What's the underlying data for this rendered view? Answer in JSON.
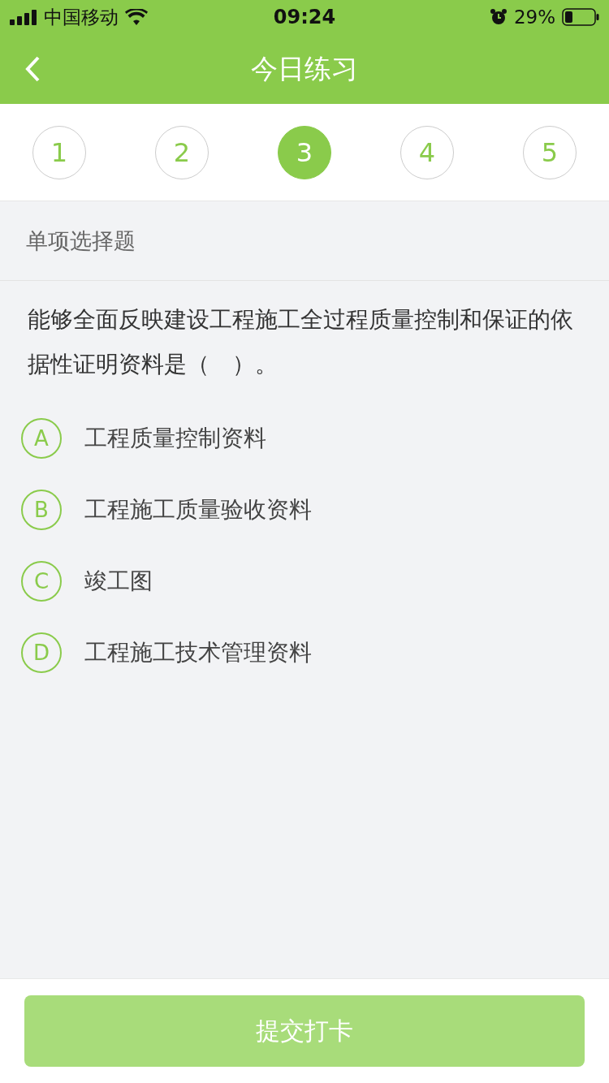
{
  "status_bar": {
    "carrier": "中国移动",
    "time": "09:24",
    "battery": "29%"
  },
  "nav": {
    "title": "今日练习"
  },
  "steps": [
    {
      "label": "1",
      "selected": false
    },
    {
      "label": "2",
      "selected": false
    },
    {
      "label": "3",
      "selected": true
    },
    {
      "label": "4",
      "selected": false
    },
    {
      "label": "5",
      "selected": false
    }
  ],
  "question": {
    "type": "单项选择题",
    "text": "能够全面反映建设工程施工全过程质量控制和保证的依据性证明资料是（　）。",
    "options": [
      {
        "letter": "A",
        "text": "工程质量控制资料",
        "selected": false
      },
      {
        "letter": "B",
        "text": "工程施工质量验收资料",
        "selected": false
      },
      {
        "letter": "C",
        "text": "竣工图",
        "selected": false
      },
      {
        "letter": "D",
        "text": "工程施工技术管理资料",
        "selected": false
      }
    ]
  },
  "submit": {
    "label": "提交打卡",
    "disabled": true
  }
}
